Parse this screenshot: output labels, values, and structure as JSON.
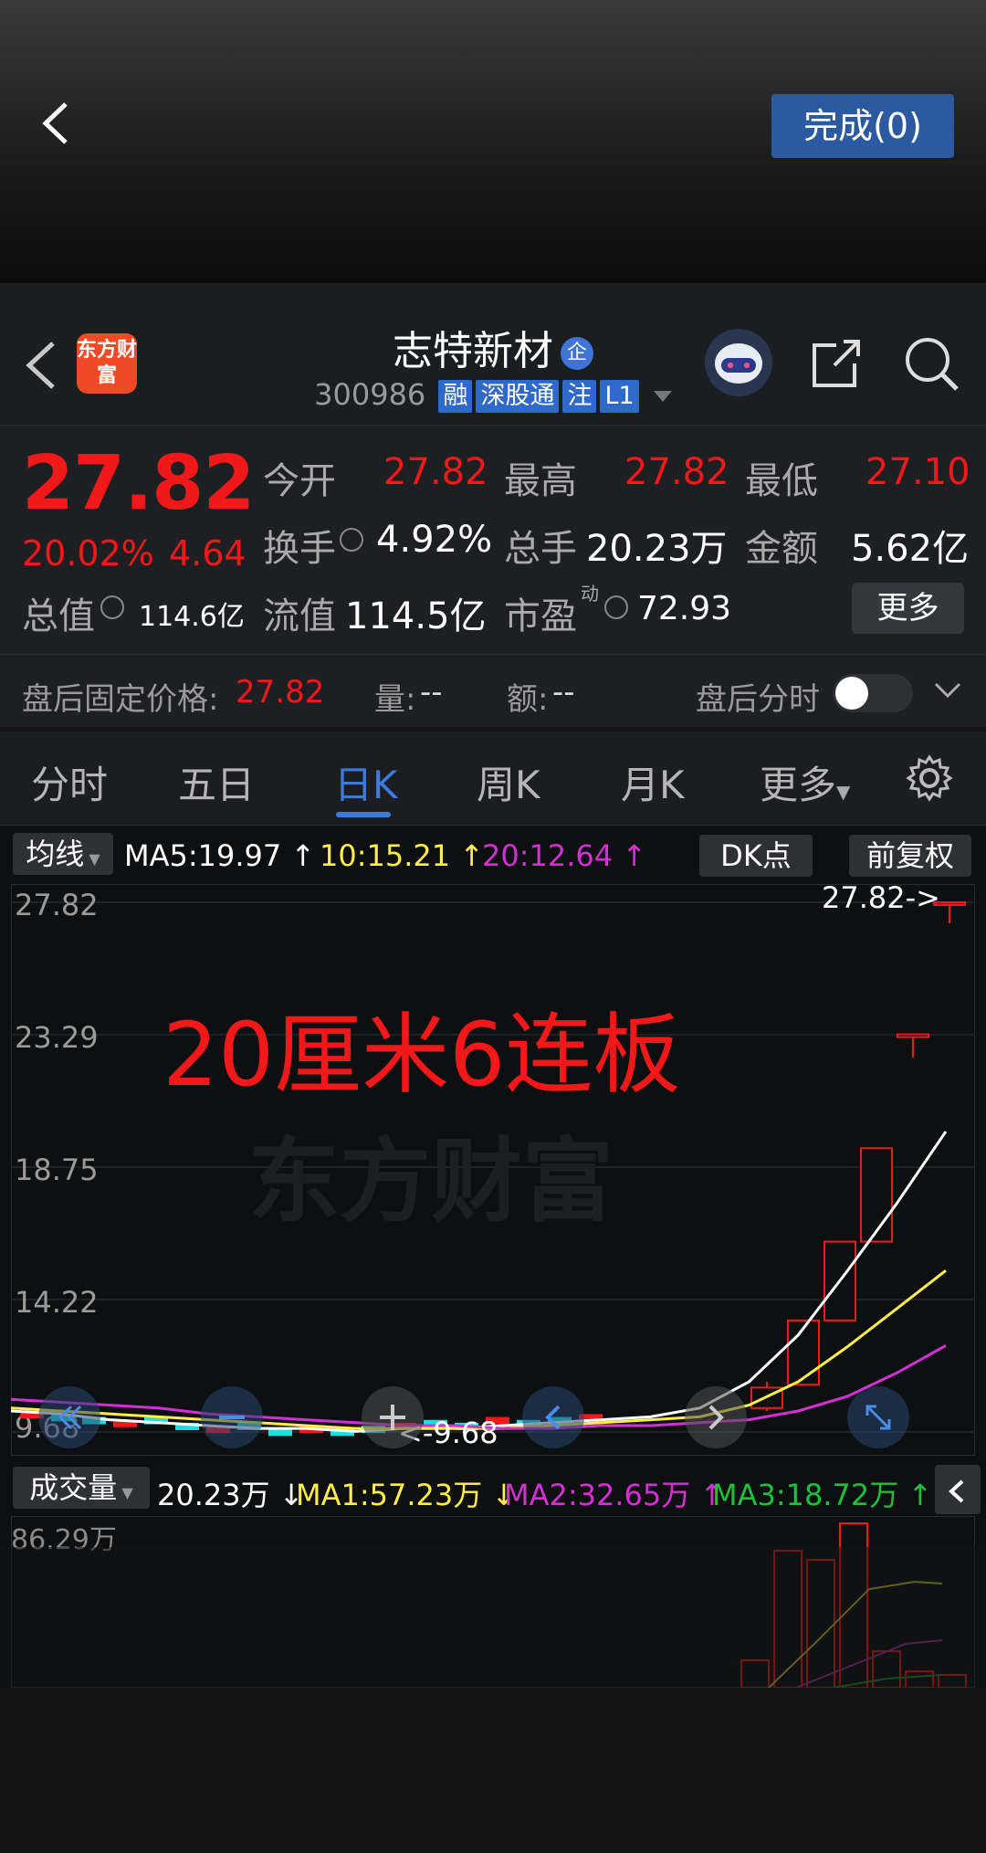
{
  "topbar": {
    "done_label": "完成(0)"
  },
  "header": {
    "logo_text": "东方财富",
    "stock_name": "志特新材",
    "qi_badge": "企",
    "code": "300986",
    "tags": [
      "融",
      "深股通",
      "注",
      "L1"
    ]
  },
  "quote": {
    "price": "27.82",
    "change_pct": "20.02%",
    "change": "4.64",
    "open_label": "今开",
    "open": "27.82",
    "high_label": "最高",
    "high": "27.82",
    "low_label": "最低",
    "low": "27.10",
    "turnover_label": "换手",
    "turnover": "4.92%",
    "volume_label": "总手",
    "volume": "20.23万",
    "amount_label": "金额",
    "amount": "5.62亿",
    "mktcap_label": "总值",
    "mktcap": "114.6亿",
    "float_label": "流值",
    "float": "114.5亿",
    "pe_label": "市盈",
    "pe_sup": "动",
    "pe": "72.93",
    "more_label": "更多"
  },
  "after_hours": {
    "fixed_price_label": "盘后固定价格:",
    "fixed_price": "27.82",
    "vol_label": "量:",
    "vol": "--",
    "amt_label": "额:",
    "amt": "--",
    "timeshare_label": "盘后分时"
  },
  "tabs": [
    "分时",
    "五日",
    "日K",
    "周K",
    "月K",
    "更多"
  ],
  "active_tab": "日K",
  "ma_bar": {
    "selector": "均线",
    "ma5": "MA5:19.97",
    "ma10": "10:15.21",
    "ma20": "20:12.64",
    "dk_label": "DK点",
    "adj_label": "前复权"
  },
  "colors": {
    "up": "#f01818",
    "down": "#19e0e0",
    "ma5": "#ffffff",
    "ma10": "#ffee44",
    "ma20": "#d42fd4",
    "accent": "#3a7be0"
  },
  "overlay_text": "20厘米6连板",
  "watermark": "东方财富",
  "vol_bar": {
    "selector": "成交量",
    "vol": "20.23万",
    "ma1": "MA1:57.23万",
    "ma2": "MA2:32.65万",
    "ma3": "MA3:18.72万"
  },
  "chart_data": {
    "type": "candlestick",
    "y_ticks": [
      "27.82",
      "23.29",
      "18.75",
      "14.22",
      "9.68"
    ],
    "ylim": [
      9.68,
      27.82
    ],
    "max_label": "27.82->",
    "min_label": "<-9.68",
    "candles_recent": [
      {
        "open": 10.5,
        "close": 11.2,
        "high": 11.4,
        "low": 10.4
      },
      {
        "open": 11.3,
        "close": 13.5,
        "high": 13.5,
        "low": 11.3
      },
      {
        "open": 13.5,
        "close": 16.2,
        "high": 16.2,
        "low": 13.5
      },
      {
        "open": 16.2,
        "close": 19.4,
        "high": 19.4,
        "low": 16.2
      },
      {
        "open": 23.3,
        "close": 23.3,
        "high": 23.3,
        "low": 22.5
      },
      {
        "open": 27.82,
        "close": 27.82,
        "high": 27.82,
        "low": 27.1
      }
    ],
    "volume_max_label": "86.29万"
  }
}
